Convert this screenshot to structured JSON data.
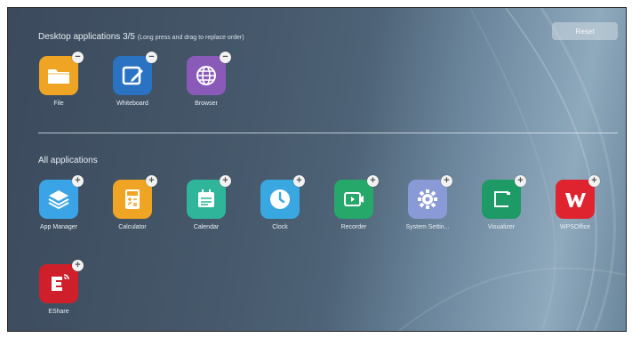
{
  "desktop": {
    "title": "Desktop applications",
    "count": "3/5",
    "hint": "(Long press and drag to replace order)",
    "reset_label": "Reset",
    "apps": [
      {
        "label": "File",
        "color": "#f0a423",
        "icon": "folder-icon"
      },
      {
        "label": "Whiteboard",
        "color": "#2a73c2",
        "icon": "whiteboard-pen-icon"
      },
      {
        "label": "Browser",
        "color": "#8a5ab8",
        "icon": "globe-icon"
      }
    ],
    "badge_symbol": "−"
  },
  "all": {
    "title": "All applications",
    "badge_symbol": "+",
    "apps": [
      {
        "label": "App Manager",
        "color": "#3ba4e6",
        "icon": "layers-icon"
      },
      {
        "label": "Calculator",
        "color": "#f0a423",
        "icon": "calculator-icon"
      },
      {
        "label": "Calendar",
        "color": "#2fb59a",
        "icon": "calendar-icon"
      },
      {
        "label": "Clock",
        "color": "#3aa8e0",
        "icon": "clock-icon"
      },
      {
        "label": "Recorder",
        "color": "#25a86a",
        "icon": "screen-record-icon"
      },
      {
        "label": "System Settin...",
        "color": "#8a9ad6",
        "icon": "gear-icon"
      },
      {
        "label": "Visualizer",
        "color": "#1e9a66",
        "icon": "document-camera-icon"
      },
      {
        "label": "WPSOffice",
        "color": "#e0242f",
        "icon": "wps-w-icon"
      },
      {
        "label": "EShare",
        "color": "#cf1f2b",
        "icon": "eshare-icon"
      }
    ]
  }
}
